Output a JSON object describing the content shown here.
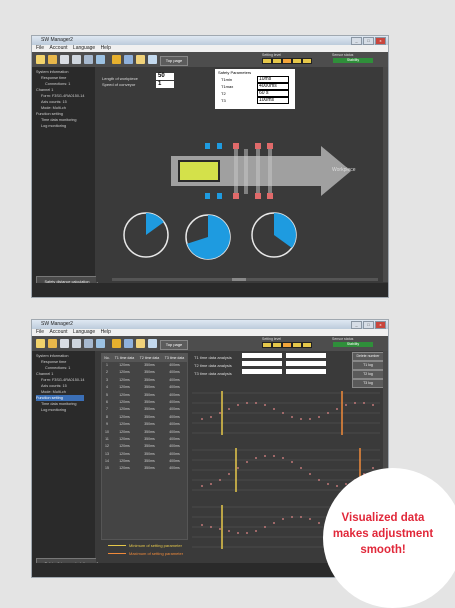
{
  "app": {
    "title": "SW Manager2"
  },
  "menu": [
    "File",
    "Account",
    "Language",
    "Help"
  ],
  "toolbar": {
    "top_page": "Top page"
  },
  "setting_level": {
    "label": "Setting level",
    "count": 5
  },
  "sensor_status": {
    "label": "Sensor status",
    "value": "Stability"
  },
  "tree": [
    {
      "label": "System information",
      "indent": 0
    },
    {
      "label": "Response time",
      "indent": 1
    },
    {
      "label": "Connections: 1",
      "indent": 2
    },
    {
      "label": "Channel 1",
      "indent": 0
    },
    {
      "label": "Form: F3SG-4RA0150-14",
      "indent": 1
    },
    {
      "label": "Axis counts: 15",
      "indent": 1
    },
    {
      "label": "Mode: Multi-ch",
      "indent": 1
    },
    {
      "label": "Function setting",
      "indent": 0
    },
    {
      "label": "Time data monitoring",
      "indent": 1
    },
    {
      "label": "Log monitoring",
      "indent": 1
    }
  ],
  "tree_selected_index_screen2": 7,
  "safety_button": "Safety distance calculation",
  "screen1": {
    "workpiece_length_label": "Length of workpiece",
    "workpiece_length_value": "50",
    "conveyor_speed_label": "Speed of conveyor",
    "conveyor_speed_value": "1",
    "safety_params_title": "Safety Parameters",
    "params": [
      {
        "name": "T1min",
        "value": "10ms"
      },
      {
        "name": "T1max",
        "value": "4000ms"
      },
      {
        "name": "T2",
        "value": "60 s"
      },
      {
        "name": "T3",
        "value": "100ms"
      }
    ],
    "arrow_text": "Workpiece",
    "pies": [
      {
        "fraction": 0.15,
        "label": ""
      },
      {
        "fraction": 0.7,
        "label": ""
      },
      {
        "fraction": 0.35,
        "label": ""
      }
    ]
  },
  "screen2": {
    "table": {
      "headers": [
        "No.",
        "T1 time data",
        "T2 time data",
        "T3 time data"
      ],
      "rows": [
        [
          "1",
          "120ms",
          "350ms",
          "400ms"
        ],
        [
          "2",
          "120ms",
          "350ms",
          "400ms"
        ],
        [
          "3",
          "120ms",
          "350ms",
          "400ms"
        ],
        [
          "4",
          "120ms",
          "350ms",
          "400ms"
        ],
        [
          "5",
          "120ms",
          "350ms",
          "400ms"
        ],
        [
          "6",
          "120ms",
          "350ms",
          "400ms"
        ],
        [
          "7",
          "120ms",
          "350ms",
          "400ms"
        ],
        [
          "8",
          "120ms",
          "350ms",
          "400ms"
        ],
        [
          "9",
          "120ms",
          "350ms",
          "400ms"
        ],
        [
          "10",
          "120ms",
          "350ms",
          "400ms"
        ],
        [
          "11",
          "120ms",
          "350ms",
          "400ms"
        ],
        [
          "12",
          "120ms",
          "350ms",
          "400ms"
        ],
        [
          "13",
          "120ms",
          "350ms",
          "400ms"
        ],
        [
          "14",
          "120ms",
          "350ms",
          "400ms"
        ],
        [
          "15",
          "120ms",
          "350ms",
          "400ms"
        ]
      ]
    },
    "analysis_labels": [
      "T1 time data analysis",
      "T2 time data analysis",
      "T3 time data analysis"
    ],
    "right_buttons": [
      "Delete number from 0.2ms",
      "T1 log",
      "T2 log",
      "T3 log"
    ],
    "legend": [
      "Minimum of setting parameter",
      "Maximum of setting parameter"
    ]
  },
  "bubble": {
    "lines": [
      "Visualized data",
      "makes adjustment",
      "smooth!"
    ]
  },
  "colors": {
    "accent": "#1e9be0",
    "highlight": "#e1283a",
    "lcd": "#d4e14a"
  }
}
